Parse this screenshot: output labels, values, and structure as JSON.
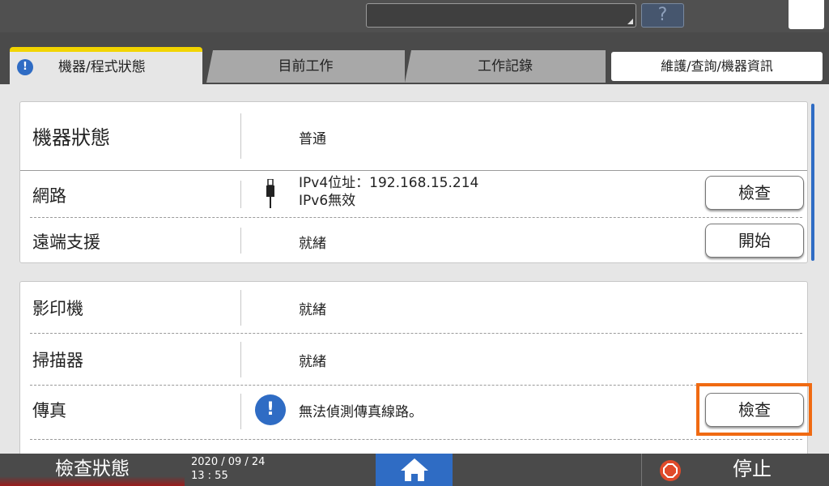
{
  "top": {
    "help_label": "?"
  },
  "tabs": [
    {
      "label": "機器/程式狀態"
    },
    {
      "label": "目前工作"
    },
    {
      "label": "工作記錄"
    },
    {
      "label": "維護/查詢/機器資訊"
    }
  ],
  "panel1": {
    "machine_status": {
      "label": "機器狀態",
      "value": "普通"
    },
    "network": {
      "label": "網路",
      "value_line1": "IPv4位址：192.168.15.214",
      "value_line2": "IPv6無效",
      "button": "檢查"
    },
    "remote": {
      "label": "遠端支援",
      "value": "就緒",
      "button": "開始"
    }
  },
  "panel2": {
    "copier": {
      "label": "影印機",
      "value": "就緒"
    },
    "scanner": {
      "label": "掃描器",
      "value": "就緒"
    },
    "fax": {
      "label": "傳真",
      "value": "無法偵測傳真線路。",
      "button": "檢查",
      "alert_icon": "!"
    }
  },
  "bottom": {
    "check_status": "檢查狀態",
    "date": "2020 / 09 / 24",
    "time": "13 : 55",
    "stop": "停止"
  },
  "colors": {
    "accent": "#2f6cc4",
    "tab_highlight": "#f2d400",
    "stop": "#e04a2a",
    "focus": "#f06a12"
  }
}
